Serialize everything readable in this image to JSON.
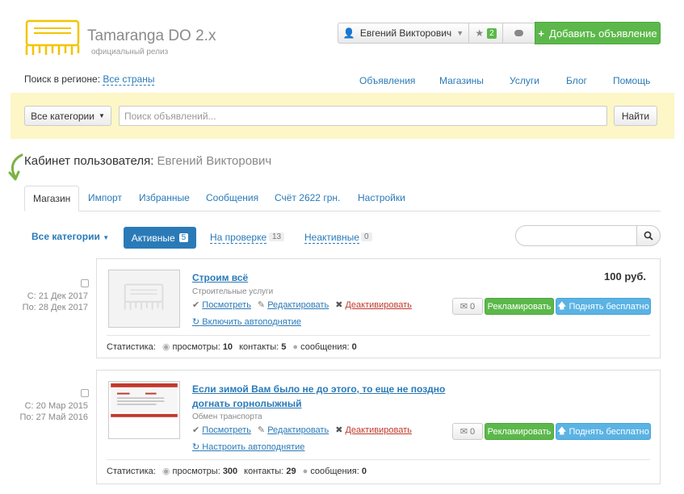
{
  "brand": {
    "title": "Tamaranga DO 2.x",
    "subtitle": "официальный релиз"
  },
  "header": {
    "user_name": "Евгений Викторович",
    "favorites_count": "2",
    "add_button": "Добавить объявление"
  },
  "region": {
    "label": "Поиск в регионе:",
    "value": "Все страны"
  },
  "topnav": [
    "Объявления",
    "Магазины",
    "Услуги",
    "Блог",
    "Помощь"
  ],
  "search": {
    "category": "Все категории",
    "placeholder": "Поиск объявлений...",
    "button": "Найти"
  },
  "cabinet": {
    "title": "Кабинет пользователя:",
    "user": "Евгений Викторович"
  },
  "tabs": [
    "Магазин",
    "Импорт",
    "Избранные",
    "Сообщения",
    "Счёт 2622 грн.",
    "Настройки"
  ],
  "filters": {
    "all_categories": "Все категории",
    "active": {
      "label": "Активные",
      "count": "5"
    },
    "review": {
      "label": "На проверке",
      "count": "13"
    },
    "inactive": {
      "label": "Неактивные",
      "count": "0"
    }
  },
  "items": [
    {
      "created": "С: 21 Дек 2017",
      "until": "По: 28 Дек 2017",
      "title": "Строим всё",
      "category": "Строительные услуги",
      "price": "100 руб.",
      "view": "Посмотреть",
      "edit": "Редактировать",
      "deactivate": "Деактивировать",
      "autoraise": "Включить автоподнятие",
      "messages_count": "0",
      "promote": "Рекламировать",
      "raise": "Поднять бесплатно",
      "stats": {
        "label": "Статистика:",
        "views_label": "просмотры:",
        "views": "10",
        "contacts_label": "контакты:",
        "contacts": "5",
        "messages_label": "сообщения:",
        "messages": "0"
      }
    },
    {
      "created": "С: 20 Мар 2015",
      "until": "По: 27 Май 2016",
      "title": "Если зимой Вам было не до этого, то еще не поздно догнать горнолыжный",
      "category": "Обмен транспорта",
      "price": "",
      "view": "Посмотреть",
      "edit": "Редактировать",
      "deactivate": "Деактивировать",
      "autoraise": "Настроить автоподнятие",
      "messages_count": "0",
      "promote": "Рекламировать",
      "raise": "Поднять бесплатно",
      "stats": {
        "label": "Статистика:",
        "views_label": "просмотры:",
        "views": "300",
        "contacts_label": "контакты:",
        "contacts": "29",
        "messages_label": "сообщения:",
        "messages": "0"
      }
    }
  ],
  "colors": {
    "accent": "#2a7ab8",
    "green": "#5cb84a",
    "light_blue": "#5bb3e4",
    "yellow_band": "#fdf6c7",
    "logo_yellow": "#f5c400"
  }
}
